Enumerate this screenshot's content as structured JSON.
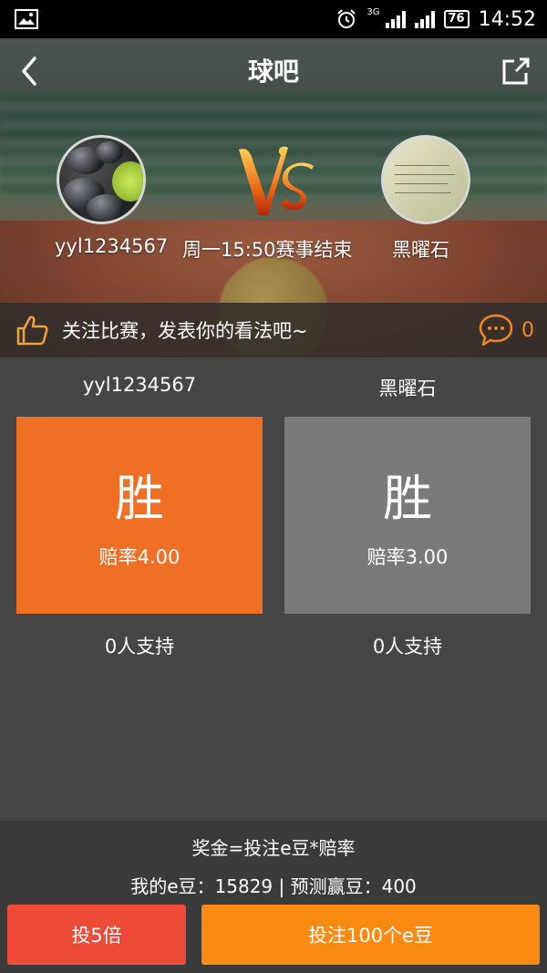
{
  "status_bar": {
    "network": "3G",
    "battery": "76",
    "time": "14:52"
  },
  "header": {
    "title": "球吧"
  },
  "match": {
    "player_left": "yyl1234567",
    "player_right": "黑曜石",
    "status": "周一15:50赛事结束"
  },
  "comment_bar": {
    "prompt": "关注比赛，发表你的看法吧~",
    "count": "0"
  },
  "bets": [
    {
      "player": "yyl1234567",
      "label": "胜",
      "odds": "赔率4.00",
      "support": "0人支持",
      "color": "#ef6f24"
    },
    {
      "player": "黑曜石",
      "label": "胜",
      "odds": "赔率3.00",
      "support": "0人支持",
      "color": "#7a7a7a"
    }
  ],
  "footer": {
    "formula": "奖金=投注e豆*赔率",
    "balance": "我的e豆：15829 | 预测赢豆：400",
    "multiplier_button": "投5倍",
    "bet_button": "投注100个e豆"
  },
  "colors": {
    "accent": "#fb8a12",
    "danger": "#ee4a38",
    "highlight": "#f08a1f"
  }
}
